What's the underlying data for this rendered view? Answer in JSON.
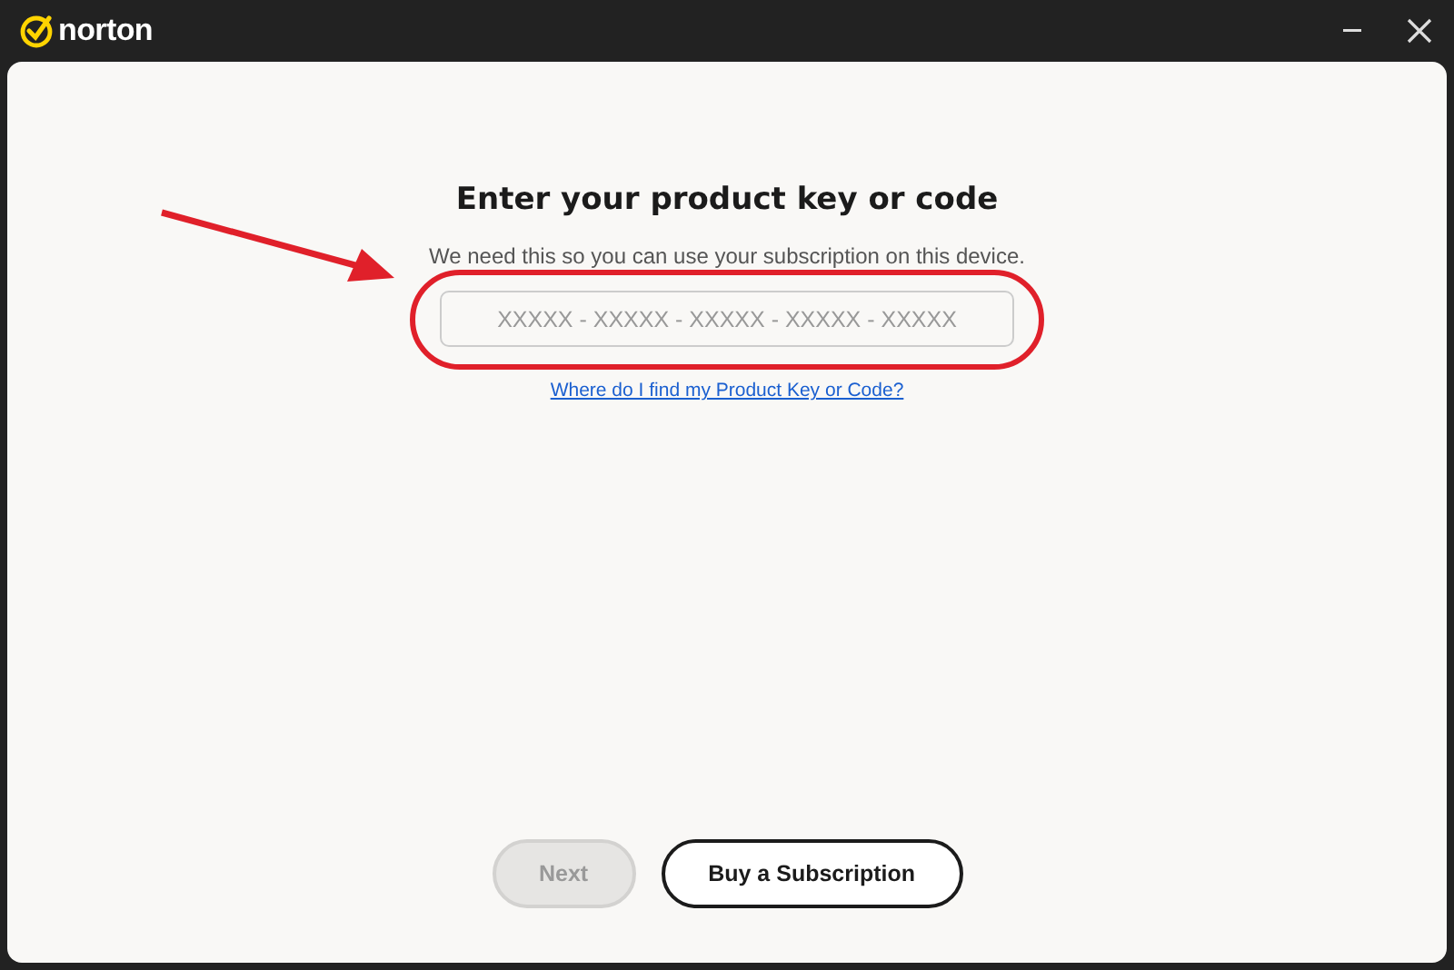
{
  "window": {
    "title": "norton"
  },
  "heading": "Enter your product key or code",
  "subtitle": "We need this so you can use your subscription on this device.",
  "key_field": {
    "placeholder": "XXXXX - XXXXX - XXXXX - XXXXX - XXXXX"
  },
  "help_link": "Where do I find my Product Key or Code?",
  "buttons": [
    {
      "label": "Next",
      "kind": "secondary",
      "disabled": true
    },
    {
      "label": "Buy a Subscription",
      "kind": "outline",
      "disabled": false
    }
  ]
}
